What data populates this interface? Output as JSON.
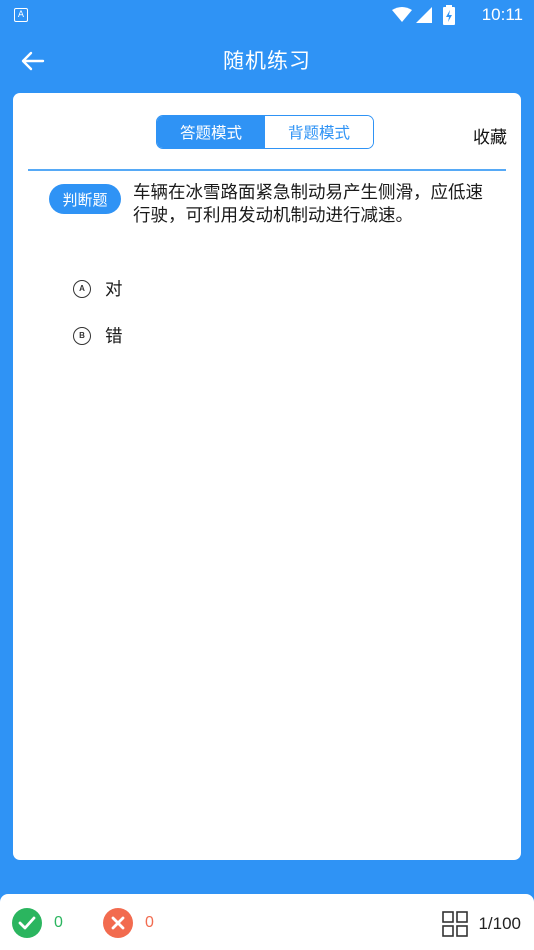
{
  "status_bar": {
    "app_icon_letter": "A",
    "time": "10:11",
    "icons": [
      "wifi-icon",
      "signal-icon",
      "battery-icon"
    ]
  },
  "app_bar": {
    "title": "随机练习",
    "back_icon": "back-arrow-icon"
  },
  "mode_toggle": {
    "answer_mode": "答题模式",
    "memorize_mode": "背题模式",
    "active": "answer_mode"
  },
  "favorite_label": "收藏",
  "question": {
    "type_label": "判断题",
    "text": "车辆在冰雪路面紧急制动易产生侧滑，应低速行驶，可利用发动机制动进行减速。",
    "options": [
      {
        "letter": "A",
        "text": "对"
      },
      {
        "letter": "B",
        "text": "错"
      }
    ]
  },
  "bottom_bar": {
    "correct_count": "0",
    "wrong_count": "0",
    "progress": "1/100"
  },
  "colors": {
    "primary": "#2f93f5",
    "correct": "#2bb55f",
    "wrong": "#f26b4f"
  }
}
